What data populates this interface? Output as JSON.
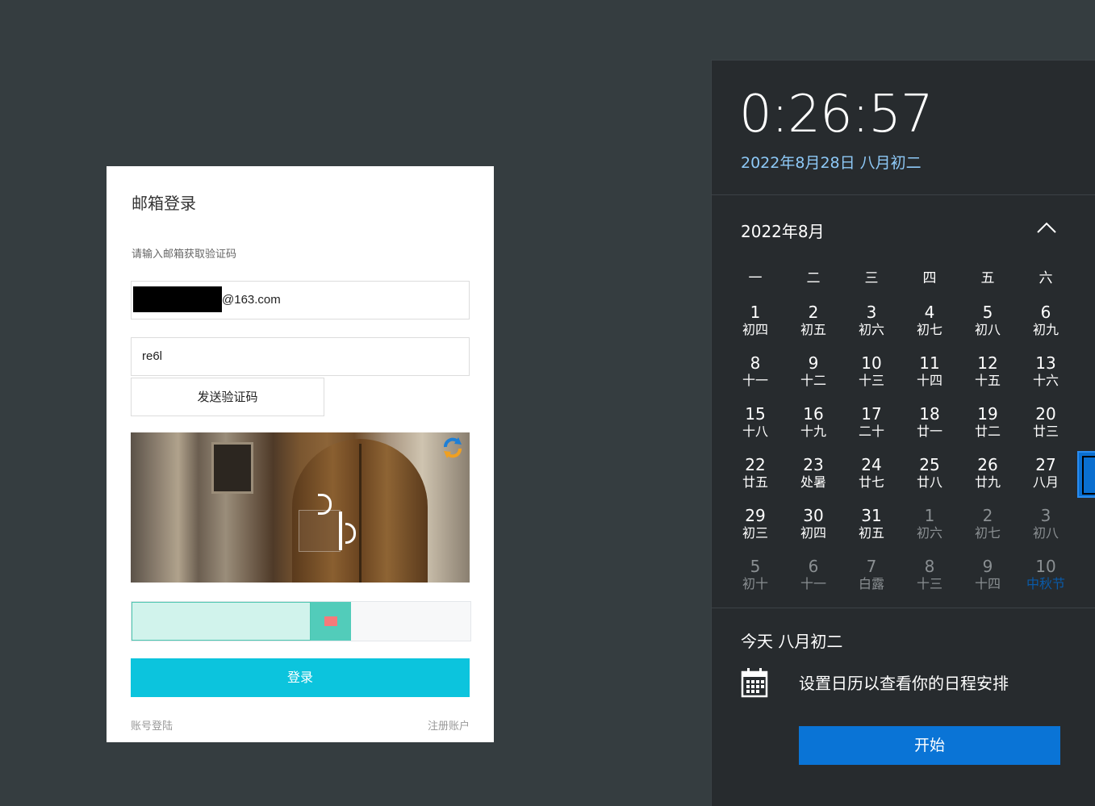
{
  "login": {
    "title": "邮箱登录",
    "hint": "请输入邮箱获取验证码",
    "email_suffix": "@163.com",
    "code_value": "re6l",
    "send_code_label": "发送验证码",
    "login_label": "登录",
    "account_login_link": "账号登陆",
    "register_link": "注册账户",
    "accent_color": "#0cc4dd"
  },
  "calendar": {
    "time": "0:26:57",
    "date_line": "2022年8月28日 八月初二",
    "month_label": "2022年8月",
    "weekdays": [
      "一",
      "二",
      "三",
      "四",
      "五",
      "六"
    ],
    "weeks": [
      [
        [
          "1",
          "初四"
        ],
        [
          "2",
          "初五"
        ],
        [
          "3",
          "初六"
        ],
        [
          "4",
          "初七"
        ],
        [
          "5",
          "初八"
        ],
        [
          "6",
          "初九"
        ]
      ],
      [
        [
          "8",
          "十一"
        ],
        [
          "9",
          "十二"
        ],
        [
          "10",
          "十三"
        ],
        [
          "11",
          "十四"
        ],
        [
          "12",
          "十五"
        ],
        [
          "13",
          "十六"
        ]
      ],
      [
        [
          "15",
          "十八"
        ],
        [
          "16",
          "十九"
        ],
        [
          "17",
          "二十"
        ],
        [
          "18",
          "廿一"
        ],
        [
          "19",
          "廿二"
        ],
        [
          "20",
          "廿三"
        ]
      ],
      [
        [
          "22",
          "廿五"
        ],
        [
          "23",
          "处暑"
        ],
        [
          "24",
          "廿七"
        ],
        [
          "25",
          "廿八"
        ],
        [
          "26",
          "廿九"
        ],
        [
          "27",
          "八月"
        ]
      ],
      [
        [
          "29",
          "初三"
        ],
        [
          "30",
          "初四"
        ],
        [
          "31",
          "初五"
        ],
        [
          "1",
          "初六"
        ],
        [
          "2",
          "初七"
        ],
        [
          "3",
          "初八"
        ]
      ],
      [
        [
          "5",
          "初十"
        ],
        [
          "6",
          "十一"
        ],
        [
          "7",
          "白露"
        ],
        [
          "8",
          "十三"
        ],
        [
          "9",
          "十四"
        ],
        [
          "10",
          "中秋节"
        ]
      ]
    ],
    "today_label": "今天 八月初二",
    "agenda_text": "设置日历以查看你的日程安排",
    "start_label": "开始",
    "accent_color": "#0a74d6"
  }
}
